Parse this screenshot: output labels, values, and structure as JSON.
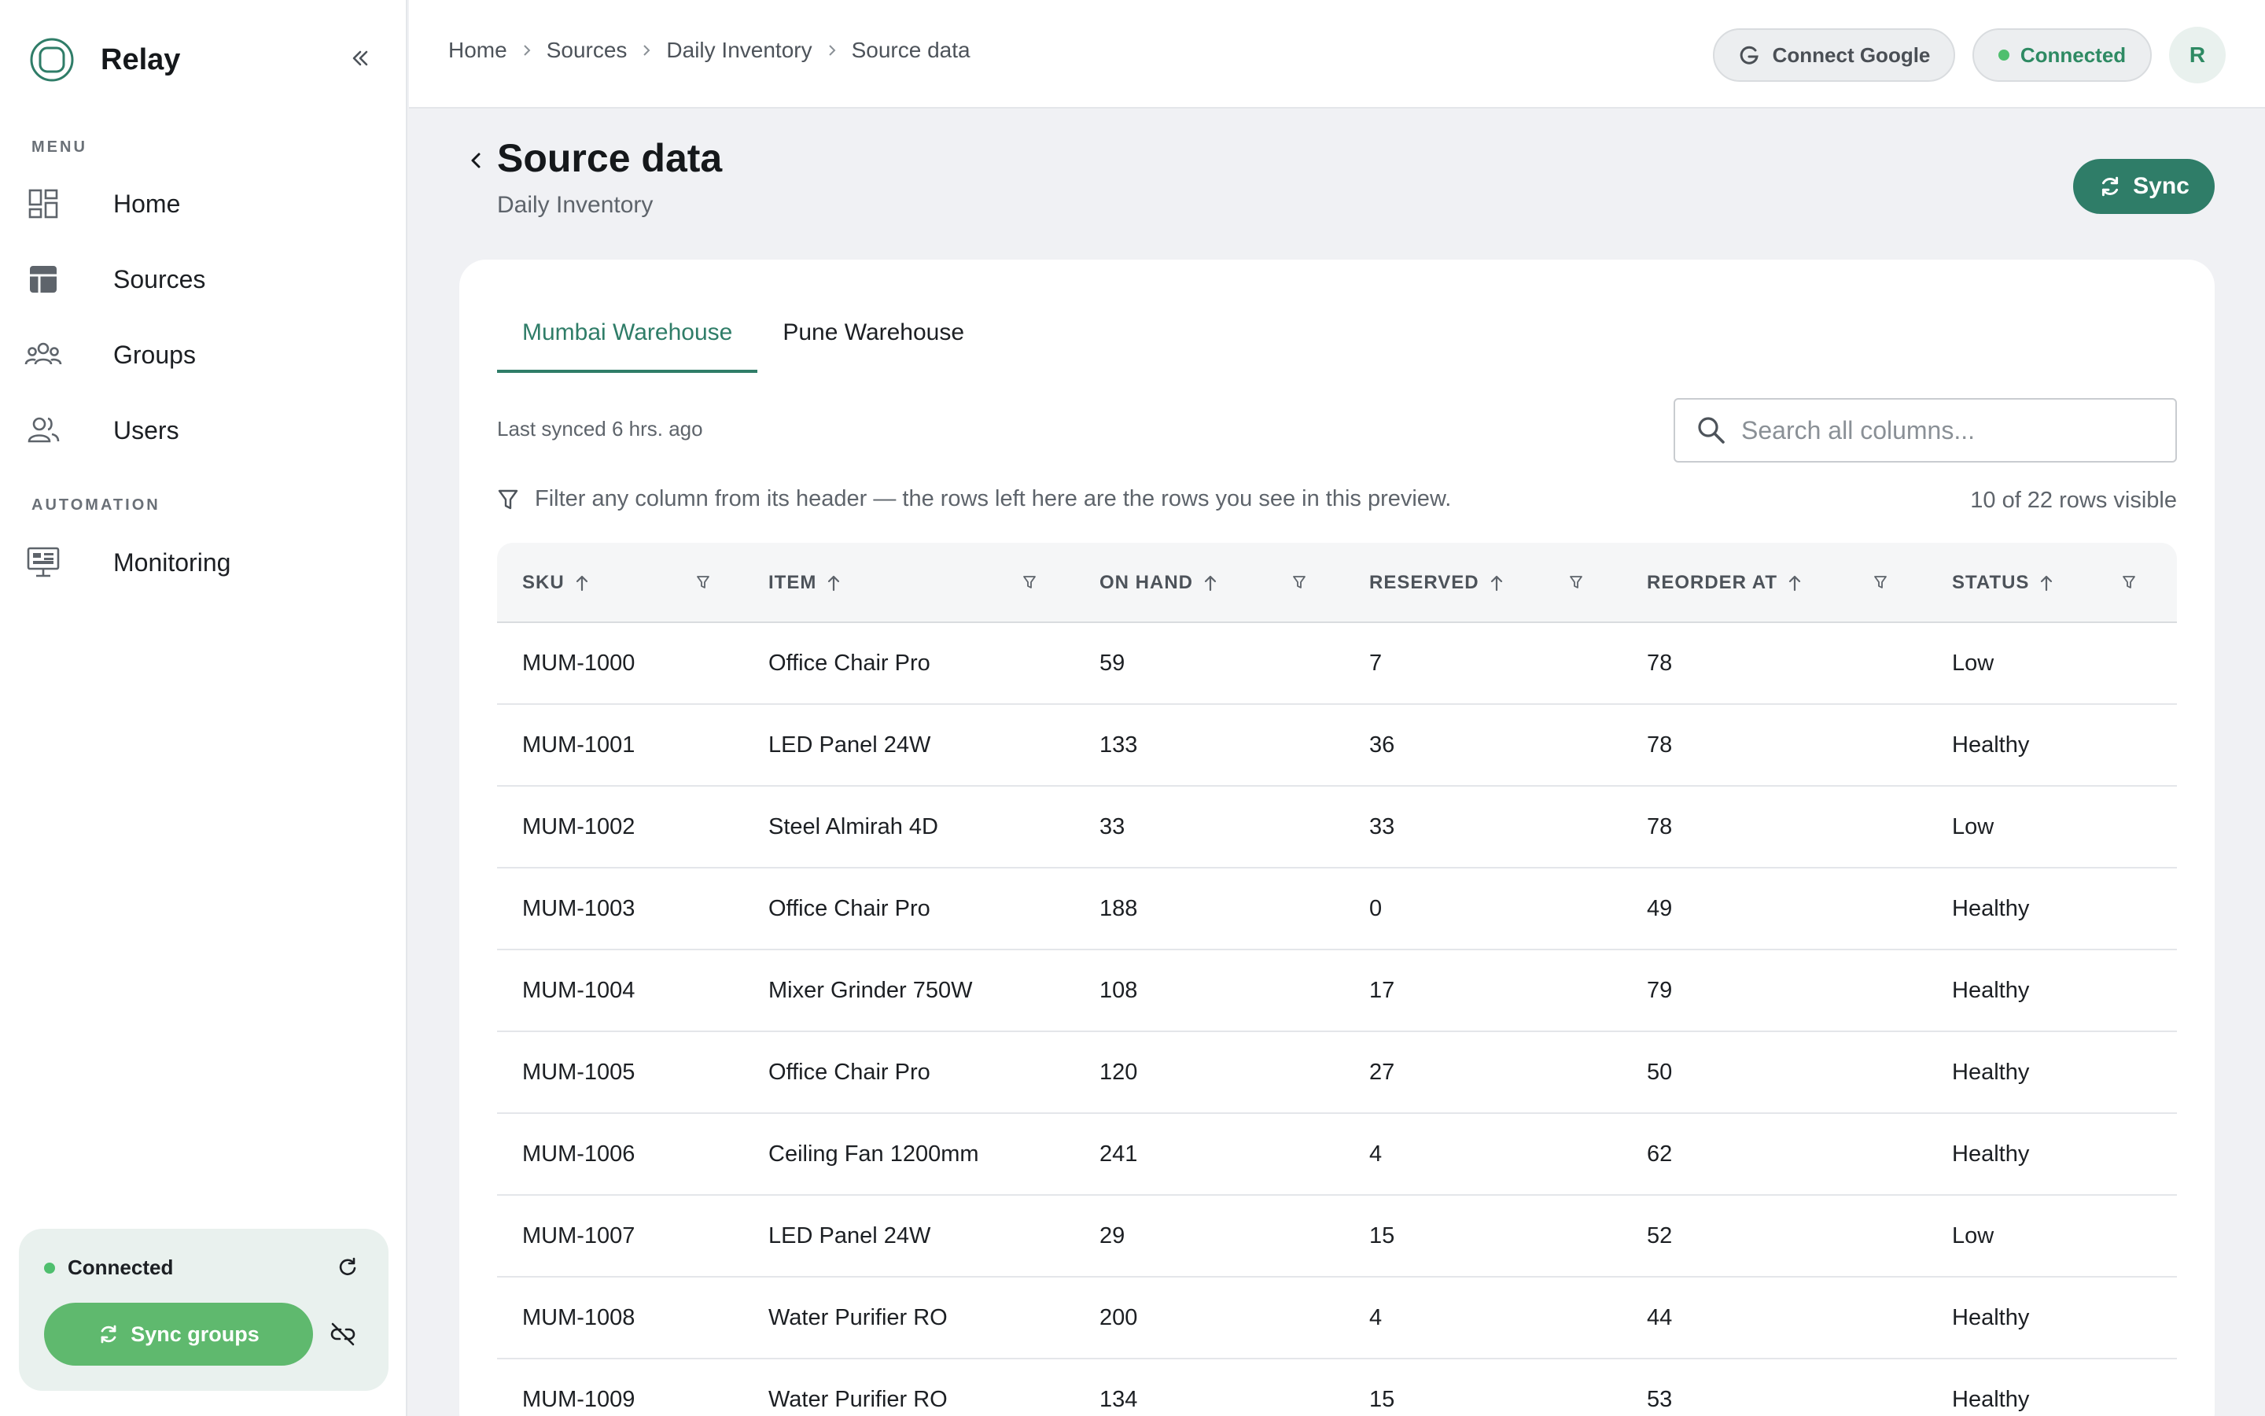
{
  "app": {
    "name": "Relay"
  },
  "sidebar": {
    "menu_label": "MENU",
    "automation_label": "AUTOMATION",
    "items": [
      {
        "label": "Home",
        "icon": "dashboard-icon"
      },
      {
        "label": "Sources",
        "icon": "table-icon"
      },
      {
        "label": "Groups",
        "icon": "groups-icon"
      },
      {
        "label": "Users",
        "icon": "users-icon"
      }
    ],
    "automation_items": [
      {
        "label": "Monitoring",
        "icon": "monitor-icon"
      }
    ],
    "status": {
      "text": "Connected",
      "sync_label": "Sync groups"
    }
  },
  "topbar": {
    "breadcrumb": [
      "Home",
      "Sources",
      "Daily Inventory",
      "Source data"
    ],
    "connect_google": "Connect Google",
    "connected": "Connected",
    "avatar_initial": "R"
  },
  "page": {
    "title": "Source data",
    "subtitle": "Daily Inventory",
    "sync_label": "Sync"
  },
  "tabs": [
    {
      "label": "Mumbai Warehouse",
      "active": true
    },
    {
      "label": "Pune Warehouse",
      "active": false
    }
  ],
  "toolbar": {
    "last_synced": "Last synced 6 hrs. ago",
    "search_placeholder": "Search all columns...",
    "filter_hint": "Filter any column from its header — the rows left here are the rows you see in this preview.",
    "row_count": "10 of 22 rows visible"
  },
  "table": {
    "columns": [
      "SKU",
      "ITEM",
      "ON HAND",
      "RESERVED",
      "REORDER AT",
      "STATUS"
    ],
    "rows": [
      [
        "MUM-1000",
        "Office Chair Pro",
        "59",
        "7",
        "78",
        "Low"
      ],
      [
        "MUM-1001",
        "LED Panel 24W",
        "133",
        "36",
        "78",
        "Healthy"
      ],
      [
        "MUM-1002",
        "Steel Almirah 4D",
        "33",
        "33",
        "78",
        "Low"
      ],
      [
        "MUM-1003",
        "Office Chair Pro",
        "188",
        "0",
        "49",
        "Healthy"
      ],
      [
        "MUM-1004",
        "Mixer Grinder 750W",
        "108",
        "17",
        "79",
        "Healthy"
      ],
      [
        "MUM-1005",
        "Office Chair Pro",
        "120",
        "27",
        "50",
        "Healthy"
      ],
      [
        "MUM-1006",
        "Ceiling Fan 1200mm",
        "241",
        "4",
        "62",
        "Healthy"
      ],
      [
        "MUM-1007",
        "LED Panel 24W",
        "29",
        "15",
        "52",
        "Low"
      ],
      [
        "MUM-1008",
        "Water Purifier RO",
        "200",
        "4",
        "44",
        "Healthy"
      ],
      [
        "MUM-1009",
        "Water Purifier RO",
        "134",
        "15",
        "53",
        "Healthy"
      ]
    ]
  },
  "colors": {
    "accent": "#2f7d68",
    "success": "#4fbf6e",
    "sync_groups": "#5fb96e",
    "background": "#f0f1f4"
  }
}
